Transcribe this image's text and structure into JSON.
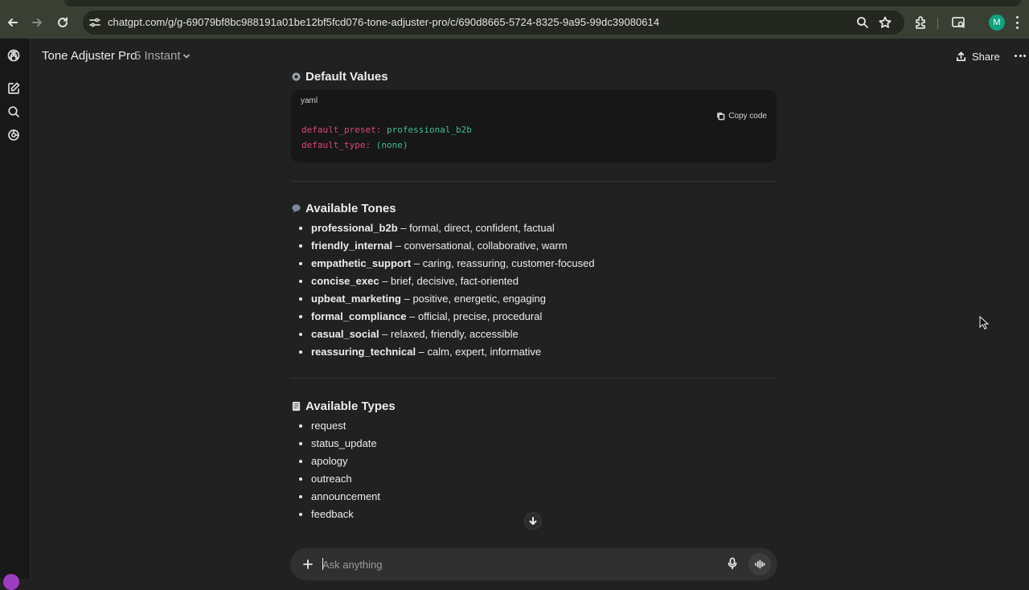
{
  "browser": {
    "url": "chatgpt.com/g/g-69079bf8bc988191a01be12bf5fcd076-tone-adjuster-pro/c/690d8665-5724-8325-9a95-99dc39080614",
    "profile_initial": "M"
  },
  "header": {
    "gpt_name": "Tone Adjuster Pro",
    "model": "5 Instant",
    "share_label": "Share"
  },
  "defaults_section": {
    "emoji": "gear-icon",
    "title": "Default Values",
    "code": {
      "lang": "yaml",
      "copy_label": "Copy code",
      "lines": [
        {
          "key": "default_preset:",
          "value": "professional_b2b"
        },
        {
          "key": "default_type:",
          "value": "(none)"
        }
      ]
    }
  },
  "tones_section": {
    "emoji": "speech-icon",
    "title": "Available Tones",
    "items": [
      {
        "name": "professional_b2b",
        "desc": " – formal, direct, confident, factual"
      },
      {
        "name": "friendly_internal",
        "desc": " – conversational, collaborative, warm"
      },
      {
        "name": "empathetic_support",
        "desc": " – caring, reassuring, customer-focused"
      },
      {
        "name": "concise_exec",
        "desc": " – brief, decisive, fact-oriented"
      },
      {
        "name": "upbeat_marketing",
        "desc": " – positive, energetic, engaging"
      },
      {
        "name": "formal_compliance",
        "desc": " – official, precise, procedural"
      },
      {
        "name": "casual_social",
        "desc": " – relaxed, friendly, accessible"
      },
      {
        "name": "reassuring_technical",
        "desc": " – calm, expert, informative"
      }
    ]
  },
  "types_section": {
    "emoji": "memo-icon",
    "title": "Available Types",
    "items": [
      "request",
      "status_update",
      "apology",
      "outreach",
      "announcement",
      "feedback"
    ]
  },
  "composer": {
    "placeholder": "Ask anything"
  }
}
